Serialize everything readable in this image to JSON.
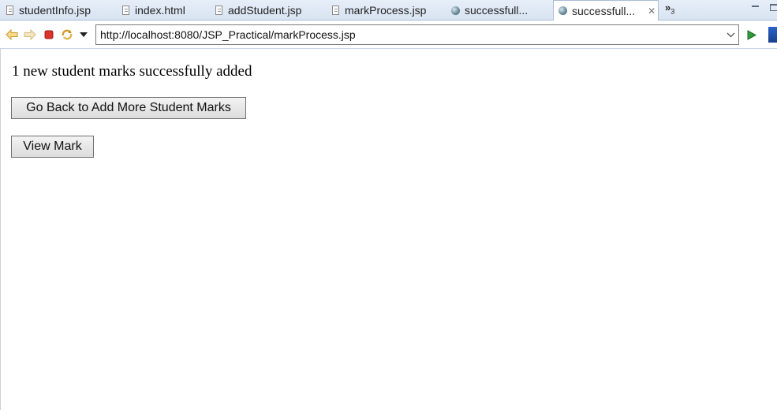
{
  "tabs": [
    {
      "label": "studentInfo.jsp",
      "icon": "file-icon"
    },
    {
      "label": "index.html",
      "icon": "file-icon"
    },
    {
      "label": "addStudent.jsp",
      "icon": "file-icon"
    },
    {
      "label": "markProcess.jsp",
      "icon": "file-icon"
    },
    {
      "label": "successfull...",
      "icon": "globe-icon"
    },
    {
      "label": "successfull...",
      "icon": "globe-icon",
      "active": true
    }
  ],
  "overflow": {
    "symbol": "»",
    "count": "3"
  },
  "toolbar": {
    "url": "http://localhost:8080/JSP_Practical/markProcess.jsp",
    "accent_stop": "#d9342b",
    "accent_go": "#2e9a3a"
  },
  "page": {
    "message": "1 new student marks successfully added",
    "back_button": "Go Back to Add More Student Marks",
    "view_button": "View Mark"
  }
}
